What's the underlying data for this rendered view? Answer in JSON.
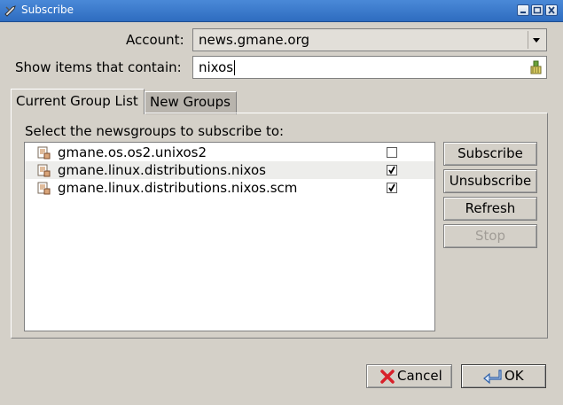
{
  "window": {
    "title": "Subscribe"
  },
  "form": {
    "account_label": "Account:",
    "account_value": "news.gmane.org",
    "filter_label": "Show items that contain:",
    "filter_value": "nixos"
  },
  "tabs": [
    {
      "label": "Current Group List",
      "active": true
    },
    {
      "label": "New Groups",
      "active": false
    }
  ],
  "list": {
    "caption": "Select the newsgroups to subscribe to:",
    "rows": [
      {
        "name": "gmane.os.os2.unixos2",
        "subscribed": false
      },
      {
        "name": "gmane.linux.distributions.nixos",
        "subscribed": true
      },
      {
        "name": "gmane.linux.distributions.nixos.scm",
        "subscribed": true
      }
    ]
  },
  "actions": {
    "subscribe": "Subscribe",
    "unsubscribe": "Unsubscribe",
    "refresh": "Refresh",
    "stop": "Stop"
  },
  "dialog_buttons": {
    "cancel": "Cancel",
    "ok": "OK"
  },
  "icons": [
    "app-icon",
    "minimize-icon",
    "maximize-icon",
    "close-icon",
    "dropdown-arrow-icon",
    "clear-field-icon",
    "newsgroup-icon",
    "checkmark-icon",
    "cancel-x-icon",
    "ok-arrow-icon"
  ],
  "colors": {
    "titlebar": "#3a7bd0",
    "window_bg": "#d4d0c8",
    "selected_row": "#ededeb",
    "disabled_text": "#a19d97"
  }
}
